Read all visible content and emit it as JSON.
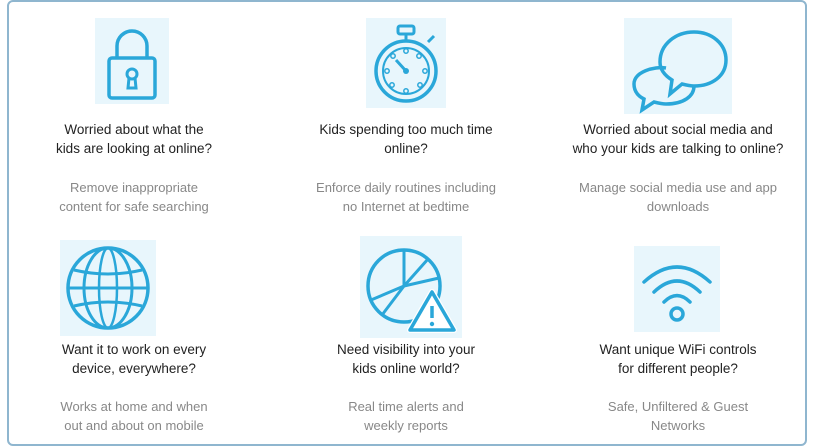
{
  "features": [
    {
      "icon": "lock-icon",
      "title_lines": [
        "Worried about what the",
        "kids are looking at online?"
      ],
      "desc_lines": [
        "Remove inappropriate",
        "content for safe searching"
      ]
    },
    {
      "icon": "stopwatch-icon",
      "title_lines": [
        "Kids spending too much time",
        "online?"
      ],
      "desc_lines": [
        "Enforce daily routines including",
        "no Internet at bedtime"
      ]
    },
    {
      "icon": "chat-bubbles-icon",
      "title_lines": [
        "Worried about social media and",
        "who your kids are talking to online?"
      ],
      "desc_lines": [
        "Manage social media use and app",
        "downloads"
      ]
    },
    {
      "icon": "globe-icon",
      "title_lines": [
        "Want it to work on every",
        "device, everywhere?"
      ],
      "desc_lines": [
        "Works at home and when",
        "out and about on mobile"
      ]
    },
    {
      "icon": "pie-chart-warning-icon",
      "title_lines": [
        "Need visibility into your",
        "kids online world?"
      ],
      "desc_lines": [
        "Real time alerts and",
        "weekly reports"
      ]
    },
    {
      "icon": "wifi-icon",
      "title_lines": [
        "Want unique WiFi controls",
        "for different people?"
      ],
      "desc_lines": [
        "Safe, Unfiltered & Guest",
        "Networks"
      ]
    }
  ],
  "colors": {
    "icon_stroke": "#2aa7d9",
    "icon_bg": "#e8f6fc",
    "title_text": "#222222",
    "desc_text": "#888888",
    "frame_border": "#8fb6cf"
  }
}
